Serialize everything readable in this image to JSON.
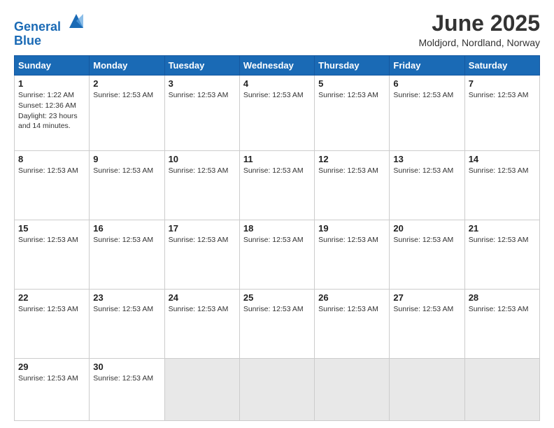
{
  "logo": {
    "line1": "General",
    "line2": "Blue"
  },
  "title": "June 2025",
  "location": "Moldjord, Nordland, Norway",
  "days_of_week": [
    "Sunday",
    "Monday",
    "Tuesday",
    "Wednesday",
    "Thursday",
    "Friday",
    "Saturday"
  ],
  "weeks": [
    [
      {
        "num": "1",
        "info": "Sunrise: 1:22 AM\nSunset: 12:36 AM\nDaylight: 23 hours and 14 minutes.",
        "empty": false
      },
      {
        "num": "2",
        "info": "Sunrise: 12:53 AM",
        "empty": false
      },
      {
        "num": "3",
        "info": "Sunrise: 12:53 AM",
        "empty": false
      },
      {
        "num": "4",
        "info": "Sunrise: 12:53 AM",
        "empty": false
      },
      {
        "num": "5",
        "info": "Sunrise: 12:53 AM",
        "empty": false
      },
      {
        "num": "6",
        "info": "Sunrise: 12:53 AM",
        "empty": false
      },
      {
        "num": "7",
        "info": "Sunrise: 12:53 AM",
        "empty": false
      }
    ],
    [
      {
        "num": "8",
        "info": "Sunrise: 12:53 AM",
        "empty": false
      },
      {
        "num": "9",
        "info": "Sunrise: 12:53 AM",
        "empty": false
      },
      {
        "num": "10",
        "info": "Sunrise: 12:53 AM",
        "empty": false
      },
      {
        "num": "11",
        "info": "Sunrise: 12:53 AM",
        "empty": false
      },
      {
        "num": "12",
        "info": "Sunrise: 12:53 AM",
        "empty": false
      },
      {
        "num": "13",
        "info": "Sunrise: 12:53 AM",
        "empty": false
      },
      {
        "num": "14",
        "info": "Sunrise: 12:53 AM",
        "empty": false
      }
    ],
    [
      {
        "num": "15",
        "info": "Sunrise: 12:53 AM",
        "empty": false
      },
      {
        "num": "16",
        "info": "Sunrise: 12:53 AM",
        "empty": false
      },
      {
        "num": "17",
        "info": "Sunrise: 12:53 AM",
        "empty": false
      },
      {
        "num": "18",
        "info": "Sunrise: 12:53 AM",
        "empty": false
      },
      {
        "num": "19",
        "info": "Sunrise: 12:53 AM",
        "empty": false
      },
      {
        "num": "20",
        "info": "Sunrise: 12:53 AM",
        "empty": false
      },
      {
        "num": "21",
        "info": "Sunrise: 12:53 AM",
        "empty": false
      }
    ],
    [
      {
        "num": "22",
        "info": "Sunrise: 12:53 AM",
        "empty": false
      },
      {
        "num": "23",
        "info": "Sunrise: 12:53 AM",
        "empty": false
      },
      {
        "num": "24",
        "info": "Sunrise: 12:53 AM",
        "empty": false
      },
      {
        "num": "25",
        "info": "Sunrise: 12:53 AM",
        "empty": false
      },
      {
        "num": "26",
        "info": "Sunrise: 12:53 AM",
        "empty": false
      },
      {
        "num": "27",
        "info": "Sunrise: 12:53 AM",
        "empty": false
      },
      {
        "num": "28",
        "info": "Sunrise: 12:53 AM",
        "empty": false
      }
    ],
    [
      {
        "num": "29",
        "info": "Sunrise: 12:53 AM",
        "empty": false
      },
      {
        "num": "30",
        "info": "Sunrise: 12:53 AM",
        "empty": false
      },
      {
        "num": "",
        "info": "",
        "empty": true
      },
      {
        "num": "",
        "info": "",
        "empty": true
      },
      {
        "num": "",
        "info": "",
        "empty": true
      },
      {
        "num": "",
        "info": "",
        "empty": true
      },
      {
        "num": "",
        "info": "",
        "empty": true
      }
    ]
  ]
}
